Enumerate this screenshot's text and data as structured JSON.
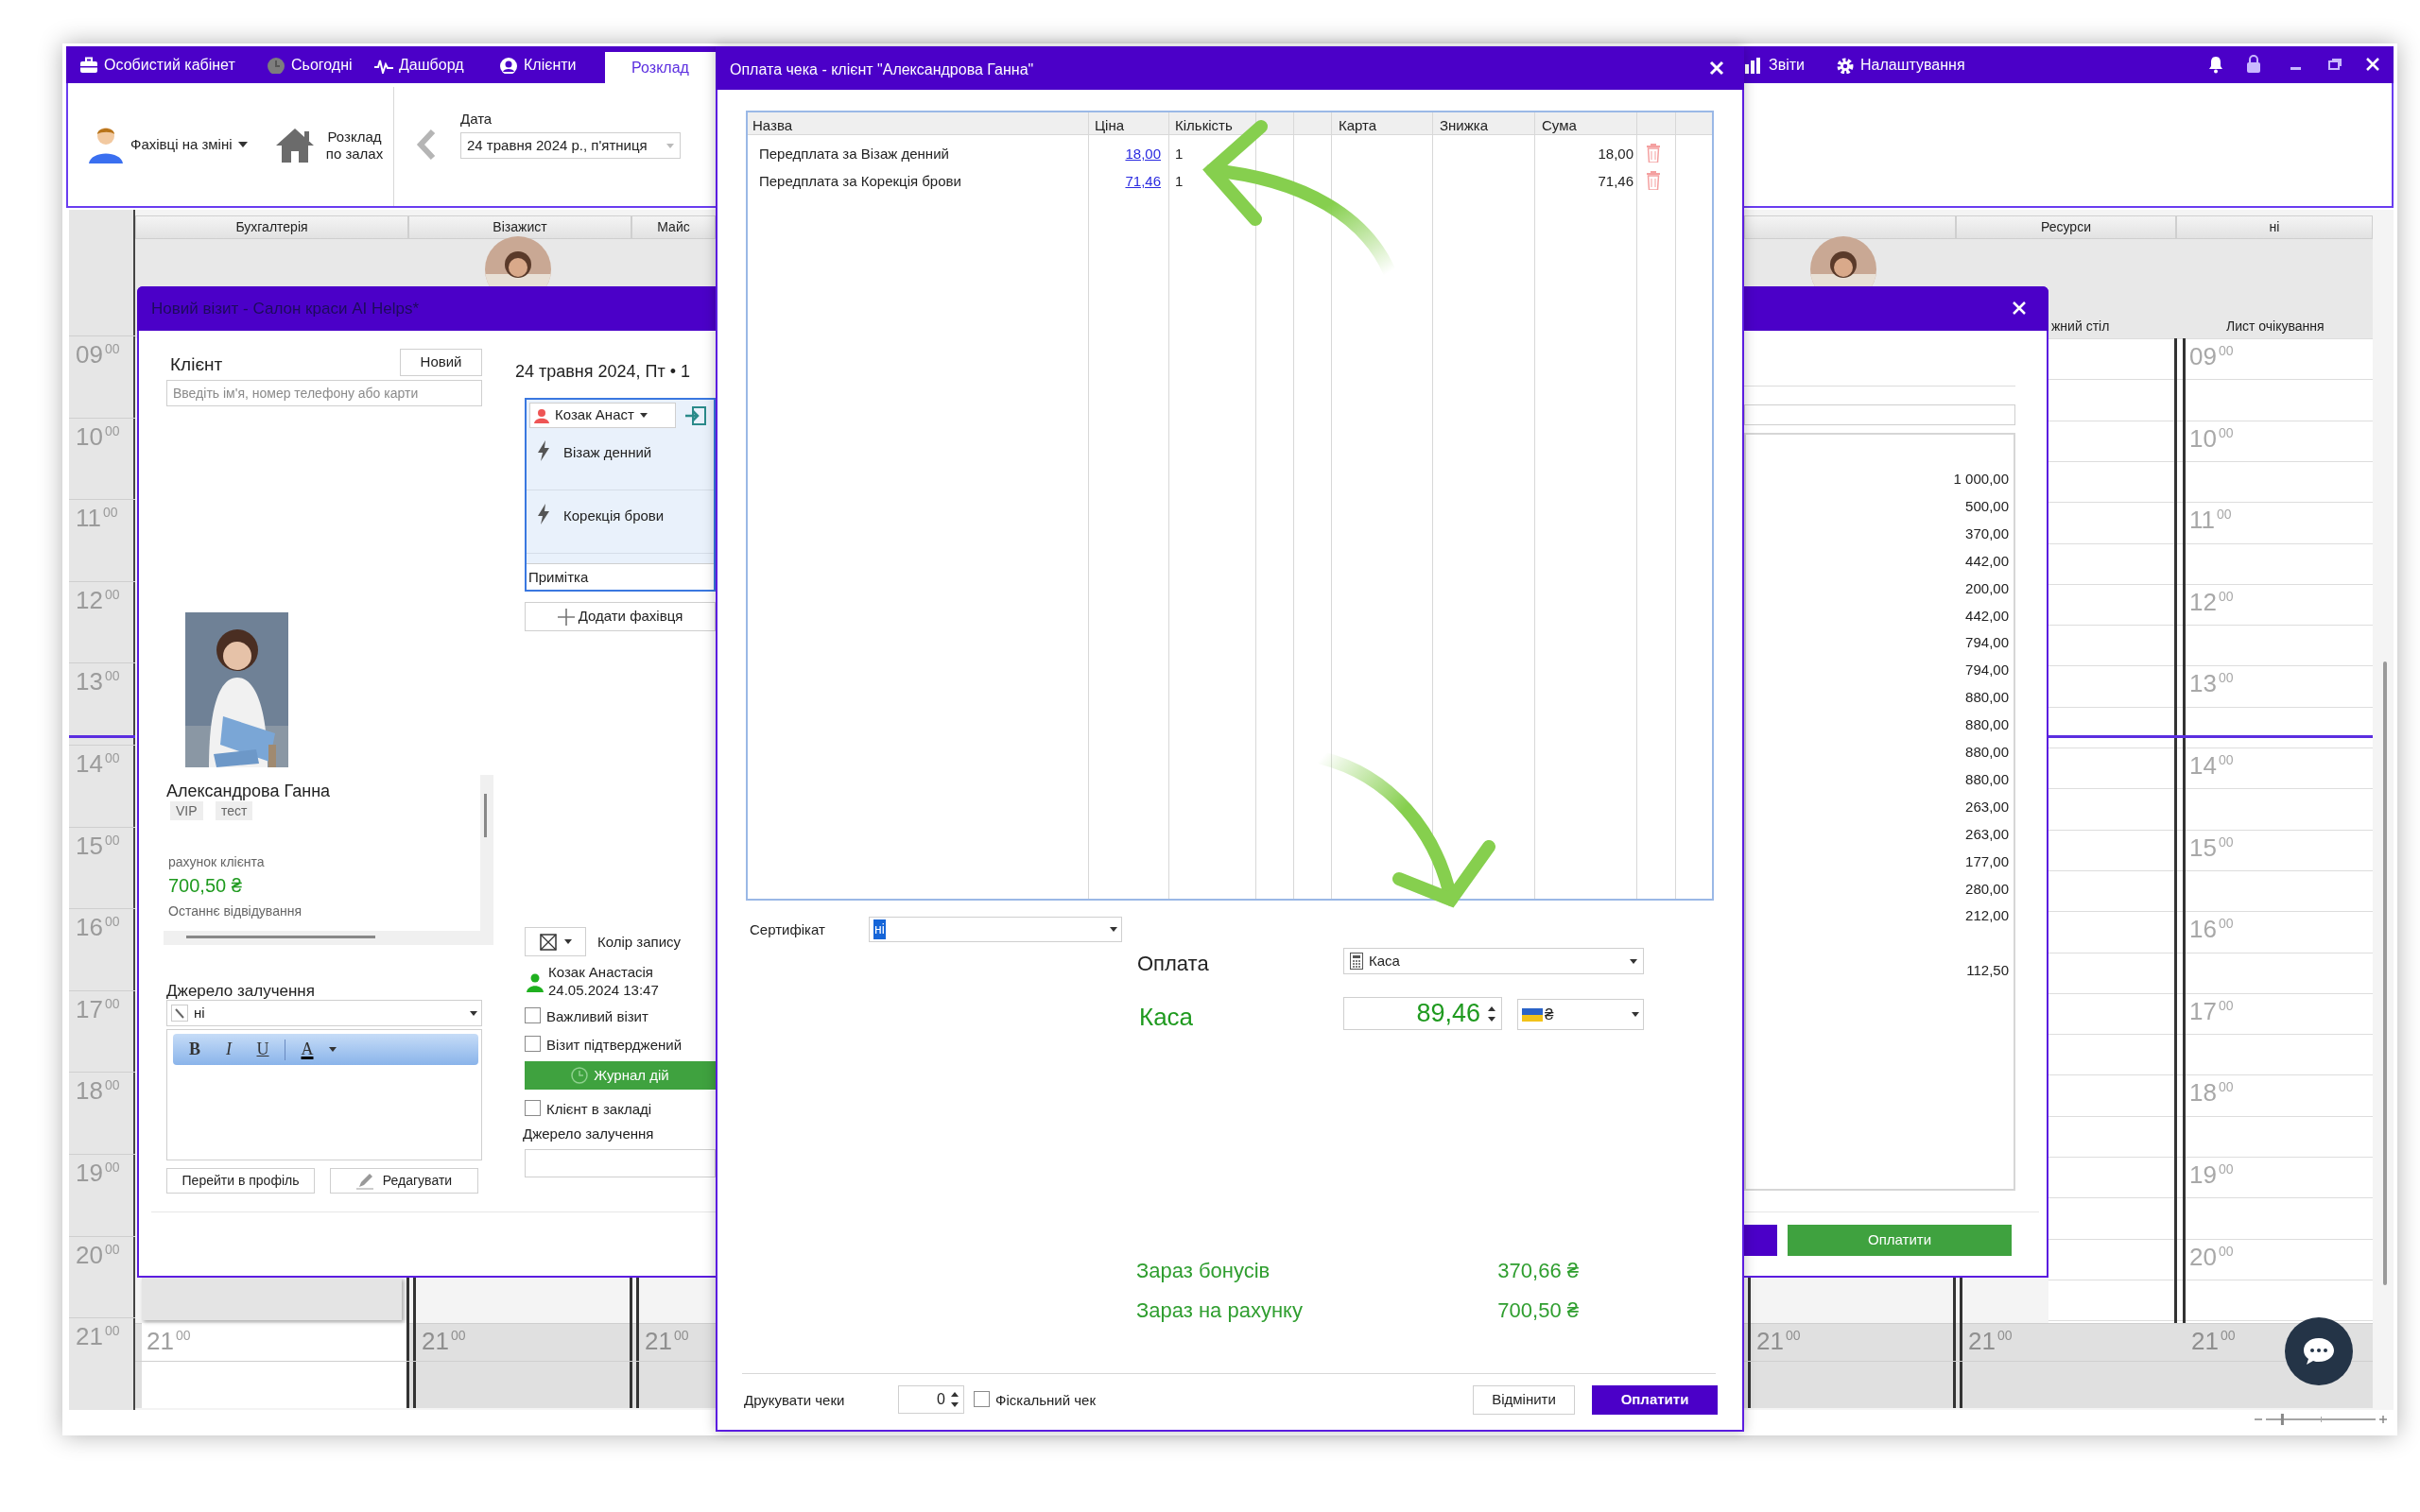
{
  "nav": {
    "tabs": [
      {
        "label": "Особистий кабінет",
        "selected": false
      },
      {
        "label": "Сьогодні",
        "selected": false
      },
      {
        "label": "Дашборд",
        "selected": false
      },
      {
        "label": "Клієнти",
        "selected": false
      },
      {
        "label": "Розклад",
        "selected": true
      }
    ],
    "right": [
      {
        "label": "Звіти"
      },
      {
        "label": "Налаштування"
      }
    ]
  },
  "zoom": {
    "level": 0.15
  },
  "toolbar": {
    "staff": "Фахівці на зміні",
    "halls": "Розклад по залах",
    "date_label": "Дата",
    "date_value": "24 травня 2024 р., п'ятниця"
  },
  "schedule": {
    "columns": [
      "Бухгалтерія",
      "Візажист",
      "Майс"
    ],
    "right_columns": [
      "Ресурси",
      "ні"
    ],
    "sub_labels": [
      "жний стіл",
      "Лист очікування"
    ],
    "hours": [
      {
        "hour": "09",
        "minutes": "00"
      },
      {
        "hour": "10",
        "minutes": "00"
      },
      {
        "hour": "11",
        "minutes": "00"
      },
      {
        "hour": "12",
        "minutes": "00"
      },
      {
        "hour": "13",
        "minutes": "00"
      },
      {
        "hour": "14",
        "minutes": "00"
      },
      {
        "hour": "15",
        "minutes": "00"
      },
      {
        "hour": "16",
        "minutes": "00"
      },
      {
        "hour": "17",
        "minutes": "00"
      },
      {
        "hour": "18",
        "minutes": "00"
      },
      {
        "hour": "19",
        "minutes": "00"
      },
      {
        "hour": "20",
        "minutes": "00"
      },
      {
        "hour": "21",
        "minutes": "00"
      }
    ],
    "waiting_hours": [
      {
        "hour": "09",
        "minutes": "00"
      },
      {
        "hour": "10",
        "minutes": "00"
      },
      {
        "hour": "11",
        "minutes": "00"
      },
      {
        "hour": "12",
        "minutes": "00"
      },
      {
        "hour": "13",
        "minutes": "00"
      },
      {
        "hour": "14",
        "minutes": "00"
      },
      {
        "hour": "15",
        "minutes": "00"
      },
      {
        "hour": "16",
        "minutes": "00"
      },
      {
        "hour": "17",
        "minutes": "00"
      },
      {
        "hour": "18",
        "minutes": "00"
      },
      {
        "hour": "19",
        "minutes": "00"
      },
      {
        "hour": "20",
        "minutes": "00"
      }
    ],
    "last_row": [
      {
        "hour": "21",
        "minutes": "00"
      },
      {
        "hour": "21",
        "minutes": "00"
      },
      {
        "hour": "21",
        "minutes": "00"
      },
      {
        "hour": "21",
        "minutes": "00"
      },
      {
        "hour": "21",
        "minutes": "00"
      },
      {
        "hour": "21",
        "minutes": "00"
      }
    ]
  },
  "visit": {
    "title": "Новий візит - Салон краси AI Helps*",
    "client_label": "Клієнт",
    "new_button": "Новий",
    "search_placeholder": "Введіть ім'я, номер телефону або карти",
    "date_heading": "24 травня 2024, Пт • 1",
    "specialist": "Козак Анаст",
    "services": [
      "Візаж денний",
      "Корекція брови"
    ],
    "note_label": "Примітка",
    "add_specialist": "Додати фахівця",
    "client": {
      "name": "Александрова Ганна",
      "tags": [
        "VIP",
        "тест"
      ],
      "account_label": "рахунок клієнта",
      "account_value": "700,50 ₴",
      "last_visit_label": "Останнє відвідування"
    },
    "source_label": "Джерело залучення",
    "source_value": "ні",
    "editor_buttons": [
      "B",
      "I",
      "U",
      "A"
    ],
    "profile_button": "Перейти в профіль",
    "edit_button": "Редагувати",
    "color_label": "Колір запису",
    "author": "Козак Анастасія",
    "created": "24.05.2024 13:47",
    "options": [
      {
        "label": "Важливий візит",
        "checked": false
      },
      {
        "label": "Візит підтверджений",
        "checked": false
      }
    ],
    "journal_button": "Журнал дій",
    "presence": {
      "label": "Клієнт в закладі",
      "checked": false
    },
    "source_label_2": "Джерело залучення",
    "amounts": [
      "1 000,00",
      "500,00",
      "370,00",
      "442,00",
      "200,00",
      "442,00",
      "794,00",
      "794,00",
      "880,00",
      "880,00",
      "880,00",
      "880,00",
      "263,00",
      "263,00",
      "177,00",
      "280,00",
      "212,00"
    ],
    "extra_amounts": [
      "112,50"
    ],
    "pay_button": "Оплатити"
  },
  "payment": {
    "title": "Оплата чека - клієнт \"Александрова Ганна\"",
    "columns": [
      "Назва",
      "Ціна",
      "Кількість",
      "Карта",
      "Знижка",
      "Сума"
    ],
    "rows": [
      {
        "name": "Передплата за Візаж денний",
        "price": "18,00",
        "quantity": "1",
        "sum": "18,00"
      },
      {
        "name": "Передплата за Корекція брови",
        "price": "71,46",
        "quantity": "1",
        "sum": "71,46"
      }
    ],
    "certificate_label": "Сертифікат",
    "certificate_value": "ні",
    "method_label": "Оплата",
    "method": "Каса",
    "cash_label": "Каса",
    "amount": "89,46",
    "currency": "₴",
    "bonus_label": "Зараз бонусів",
    "bonus_value": "370,66 ₴",
    "account_label": "Зараз на рахунку",
    "account_value": "700,50 ₴",
    "print_label": "Друкувати чеки",
    "print_count": "0",
    "fiscal": {
      "label": "Фіскальний чек",
      "checked": false
    },
    "cancel_button": "Відмінити",
    "pay_button": "Оплатити"
  }
}
